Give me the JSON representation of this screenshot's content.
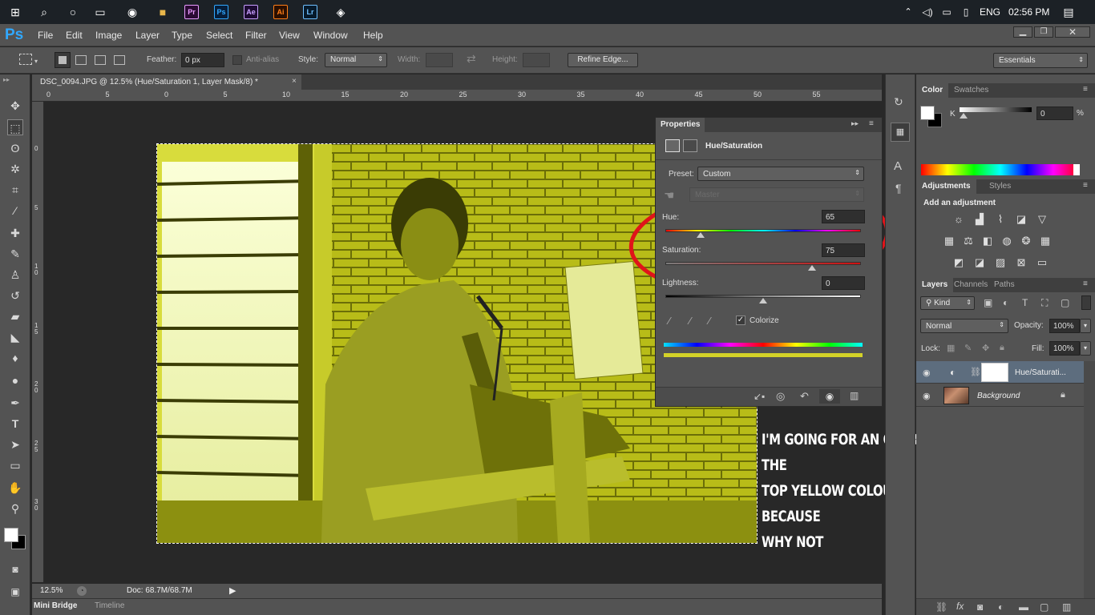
{
  "taskbar": {
    "apps": [
      "Pr",
      "Ps",
      "Ae",
      "Ai",
      "Lr"
    ],
    "language": "ENG",
    "time": "02:56 PM"
  },
  "menubar": {
    "logo": "Ps",
    "items": [
      "File",
      "Edit",
      "Image",
      "Layer",
      "Type",
      "Select",
      "Filter",
      "View",
      "Window",
      "Help"
    ]
  },
  "options": {
    "feather_label": "Feather:",
    "feather_value": "0 px",
    "antialias_label": "Anti-alias",
    "style_label": "Style:",
    "style_value": "Normal",
    "width_label": "Width:",
    "height_label": "Height:",
    "refine_edge": "Refine Edge...",
    "workspace": "Essentials"
  },
  "document": {
    "tab_title": "DSC_0094.JPG @ 12.5% (Hue/Saturation 1, Layer Mask/8) *",
    "zoom": "12.5%",
    "doc_size": "Doc: 68.7M/68.7M",
    "ruler_h": [
      "0",
      "5",
      "0",
      "5",
      "10",
      "15",
      "20",
      "25",
      "30",
      "35",
      "40",
      "45",
      "50",
      "55"
    ],
    "ruler_v": [
      "0",
      "5",
      "1 0",
      "1 5",
      "2 0",
      "2 5",
      "3 0"
    ]
  },
  "bottom_tabs": [
    "Mini Bridge",
    "Timeline"
  ],
  "properties": {
    "tab": "Properties",
    "title": "Hue/Saturation",
    "preset_label": "Preset:",
    "preset_value": "Custom",
    "channel_value": "Master",
    "hue_label": "Hue:",
    "hue_value": "65",
    "saturation_label": "Saturation:",
    "saturation_value": "75",
    "lightness_label": "Lightness:",
    "lightness_value": "0",
    "colorize_label": "Colorize",
    "colorize_checked": true,
    "hue_position": 0.18,
    "saturation_position": 0.75,
    "lightness_position": 0.5
  },
  "color_panel": {
    "tabs": [
      "Color",
      "Swatches"
    ],
    "channel_label": "K",
    "channel_value": "0",
    "unit": "%"
  },
  "adjustments_panel": {
    "tabs": [
      "Adjustments",
      "Styles"
    ],
    "heading": "Add an adjustment"
  },
  "layers_panel": {
    "tabs": [
      "Layers",
      "Channels",
      "Paths"
    ],
    "filter_kind": "Kind",
    "blend_mode": "Normal",
    "opacity_label": "Opacity:",
    "opacity_value": "100%",
    "lock_label": "Lock:",
    "fill_label": "Fill:",
    "fill_value": "100%",
    "layers": [
      {
        "name": "Hue/Saturati...",
        "selected": true
      },
      {
        "name": "Background",
        "selected": false
      }
    ]
  },
  "annotation": {
    "lines": [
      "I'M GOING FOR AN OVER THE",
      "TOP YELLOW COLOUR BECAUSE",
      "WHY NOT"
    ]
  },
  "colors": {
    "ps_panel": "#535353",
    "canvas_bg": "#282828",
    "selected_layer": "#5d6d7e",
    "annotation_circle": "#e0141a",
    "photo_tint": "#c8cc1e"
  }
}
